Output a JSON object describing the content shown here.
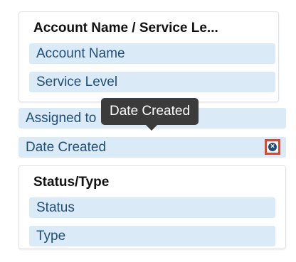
{
  "account_panel": {
    "title": "Account Name / Service Le...",
    "fields": [
      "Account Name",
      "Service Level"
    ]
  },
  "standalone_fields": {
    "assigned_label": "Assigned to",
    "date_created_label": "Date Created"
  },
  "tooltip": {
    "text": "Date Created"
  },
  "status_panel": {
    "title": "Status/Type",
    "fields": [
      "Status",
      "Type"
    ]
  },
  "icons": {
    "remove": "close-circle-icon"
  },
  "colors": {
    "field_bg": "#dbeaf7",
    "field_text": "#1f4e79",
    "highlight": "#e0432f",
    "tooltip_bg": "#3b3b3b"
  }
}
